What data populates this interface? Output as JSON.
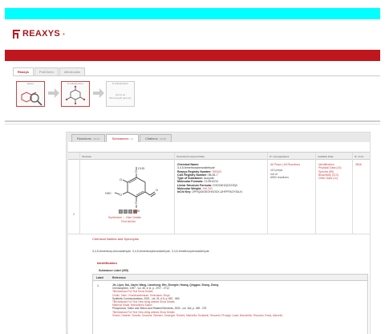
{
  "brand": {
    "logo_text": "REAXYS",
    "reg": "®",
    "cyan_color": "#00ffff",
    "red_color": "#c0171e"
  },
  "query_tabs": [
    "Reaxys",
    "PubChem",
    "eMolecules"
  ],
  "query": {
    "box1_caption": "Query",
    "box2_caption": "R substructure",
    "box3_caption": "R substructure",
    "box3_text": "as/not as\nBrowsing(R (group))"
  },
  "results": {
    "tabs": [
      {
        "label": "Reactions",
        "count": "(6548)"
      },
      {
        "label": "Substances",
        "count": "(1)"
      },
      {
        "label": "Citations",
        "count": "(3848)"
      }
    ],
    "columns": [
      "Structure",
      "Structure/Compound Data",
      "N° of preparations",
      "Available Data",
      "N° of ref."
    ],
    "prep_links": "All Preps | All Reactions",
    "row": {
      "number": "1",
      "mol_labels": {
        "ch3_top": "CH3",
        "ch3_left": "H3C",
        "ch3_bottom": "CH3",
        "o1": "O",
        "o2": "O",
        "o3": "O",
        "o4": "O"
      },
      "links": {
        "synthesis": "Synthesize",
        "hide": "Hide Details",
        "similar": "Find similar"
      },
      "compound": {
        "name_label": "Chemical Name:",
        "name": "3,4,5-trimethoxybenzaldehyde",
        "rn_label": "Reaxys Registry Number:",
        "rn": "395162",
        "cas_label": "CAS Registry Number:",
        "cas": "86-81-7",
        "type_label": "Type of Substance:",
        "type": "isocyclic",
        "mf_label": "Molecular Formula:",
        "mf": "C10H12O4",
        "lsf_label": "Linear Structure Formula:",
        "lsf": "CHOC6H2(OCH3)3",
        "mw_label": "Molecular Weight:",
        "mw": "196.203",
        "inchi_label": "InChI Key:",
        "inchi": "OPHQOIGEOHXOGX-UHFFFAOYSA-N"
      },
      "preps": "110 preps\nout of\n6553 reactions",
      "available": [
        "Identification",
        "Physical Data (14)",
        "Spectra (89)",
        "Bioactivity (213)",
        "Other Data (11)"
      ],
      "nref": "3846"
    },
    "chem_names_title": "Chemical Names and Synonyms",
    "synonyms": "3,4,5-trimethoxy-benzaldehyde, 3,4,5-trimethoxybenzaldehyde, 3,4,5-trimethoxybenzaldehyde",
    "identification_title": "Identification",
    "substance_label": "Substance Label (355)",
    "ref_header": {
      "label": "Label",
      "reference": "Reference"
    },
    "ref_entries": {
      "num": "1.",
      "authors1": "Jin, Lijun; Dai, Jiayin; Wang, Lianzhong; Wei, Zhonghe; Huang, Qingguo; Zhang, Zheng",
      "journal1": "Chemosphere, 1997 , vol. 35, # 11, p. 2707 - 2712",
      "links1": "Title/Abstract     Full Text     Show Details",
      "authors2": "Chidiu, Varni; Chandrasekharan; Srinivasan; Singh",
      "journal2": "Synthetic Communications, 2001 , vol. 31, # 5, p. 657 - 660",
      "links2": "Title/Abstract     Full Text     View citing articles     Show Details",
      "authors3": "Mattmuli Saadi; Mohammed Saaim",
      "journal3": "Phosphorus, Sulfur and Silicon and Related Elements, 2000 , vol. 164, p. 269 - 275",
      "links3": "Title/Abstract     Full Text     View citing articles     Show Details",
      "authors4": "Simoni, Daniele; Grisolia, Giovanni; Giannini, Giuseppe; Roberti, Marinella; Rondanin, Riccardo; Piccagli, Laura; Baruchello, Riccardo; Rossi, Marcello;"
    }
  }
}
